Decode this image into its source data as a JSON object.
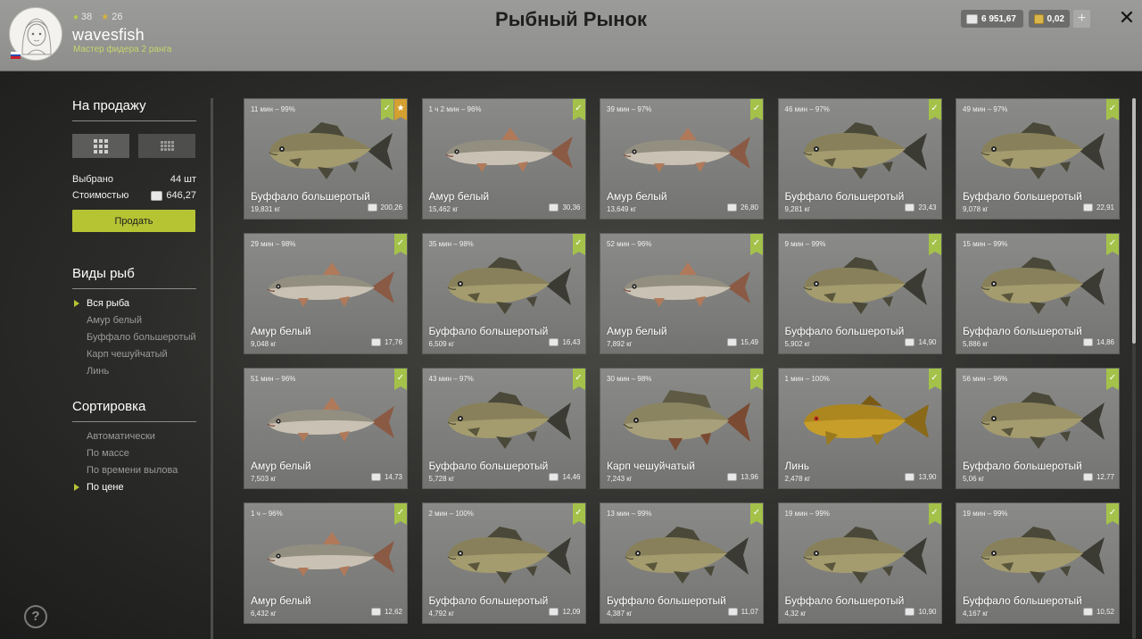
{
  "profile": {
    "coins": "38",
    "stars": "26",
    "username": "wavesfish",
    "rank": "Мастер фидера 2 ранга"
  },
  "title": "Рыбный Рынок",
  "balance": {
    "silver": "6 951,67",
    "gold": "0,02"
  },
  "sidebar": {
    "sale_title": "На продажу",
    "selected_label": "Выбрано",
    "selected_value": "44 шт",
    "cost_label": "Стоимостью",
    "cost_value": "646,27",
    "sell_button": "Продать",
    "species_title": "Виды рыб",
    "species": [
      "Вся рыба",
      "Амур белый",
      "Буффало большеротый",
      "Карп чешуйчатый",
      "Линь"
    ],
    "sort_title": "Сортировка",
    "sort_options": [
      "Автоматически",
      "По массе",
      "По времени вылова",
      "По цене"
    ]
  },
  "fish_types": {
    "buffalo": "Буффало большеротый",
    "amur": "Амур белый",
    "carp": "Карп чешуйчатый",
    "tench": "Линь"
  },
  "cards": [
    {
      "catch": "11 мин – 99%",
      "name": "Буффало большеротый",
      "type": "buffalo",
      "weight": "19,831 кг",
      "price": "200,26",
      "star": true
    },
    {
      "catch": "1 ч 2 мин – 96%",
      "name": "Амур белый",
      "type": "amur",
      "weight": "15,462 кг",
      "price": "30,36"
    },
    {
      "catch": "39 мин – 97%",
      "name": "Амур белый",
      "type": "amur",
      "weight": "13,649 кг",
      "price": "26,80"
    },
    {
      "catch": "46 мин – 97%",
      "name": "Буффало большеротый",
      "type": "buffalo",
      "weight": "9,281 кг",
      "price": "23,43"
    },
    {
      "catch": "49 мин – 97%",
      "name": "Буффало большеротый",
      "type": "buffalo",
      "weight": "9,078 кг",
      "price": "22,91"
    },
    {
      "catch": "29 мин – 98%",
      "name": "Амур белый",
      "type": "amur",
      "weight": "9,048 кг",
      "price": "17,76"
    },
    {
      "catch": "35 мин – 98%",
      "name": "Буффало большеротый",
      "type": "buffalo",
      "weight": "6,509 кг",
      "price": "16,43"
    },
    {
      "catch": "52 мин – 96%",
      "name": "Амур белый",
      "type": "amur",
      "weight": "7,892 кг",
      "price": "15,49"
    },
    {
      "catch": "9 мин – 99%",
      "name": "Буффало большеротый",
      "type": "buffalo",
      "weight": "5,902 кг",
      "price": "14,90"
    },
    {
      "catch": "15 мин – 99%",
      "name": "Буффало большеротый",
      "type": "buffalo",
      "weight": "5,886 кг",
      "price": "14,86"
    },
    {
      "catch": "51 мин – 96%",
      "name": "Амур белый",
      "type": "amur",
      "weight": "7,503 кг",
      "price": "14,73"
    },
    {
      "catch": "43 мин – 97%",
      "name": "Буффало большеротый",
      "type": "buffalo",
      "weight": "5,728 кг",
      "price": "14,46"
    },
    {
      "catch": "30 мин – 98%",
      "name": "Карп чешуйчатый",
      "type": "carp",
      "weight": "7,243 кг",
      "price": "13,96"
    },
    {
      "catch": "1 мин – 100%",
      "name": "Линь",
      "type": "tench",
      "weight": "2,478 кг",
      "price": "13,90"
    },
    {
      "catch": "56 мин – 96%",
      "name": "Буффало большеротый",
      "type": "buffalo",
      "weight": "5,06 кг",
      "price": "12,77"
    },
    {
      "catch": "1 ч – 96%",
      "name": "Амур белый",
      "type": "amur",
      "weight": "6,432 кг",
      "price": "12,62"
    },
    {
      "catch": "2 мин – 100%",
      "name": "Буффало большеротый",
      "type": "buffalo",
      "weight": "4,792 кг",
      "price": "12,09"
    },
    {
      "catch": "13 мин – 99%",
      "name": "Буффало большеротый",
      "type": "buffalo",
      "weight": "4,387 кг",
      "price": "11,07"
    },
    {
      "catch": "19 мин – 99%",
      "name": "Буффало большеротый",
      "type": "buffalo",
      "weight": "4,32 кг",
      "price": "10,90"
    },
    {
      "catch": "19 мин – 99%",
      "name": "Буффало большеротый",
      "type": "buffalo",
      "weight": "4,167 кг",
      "price": "10,52"
    }
  ]
}
